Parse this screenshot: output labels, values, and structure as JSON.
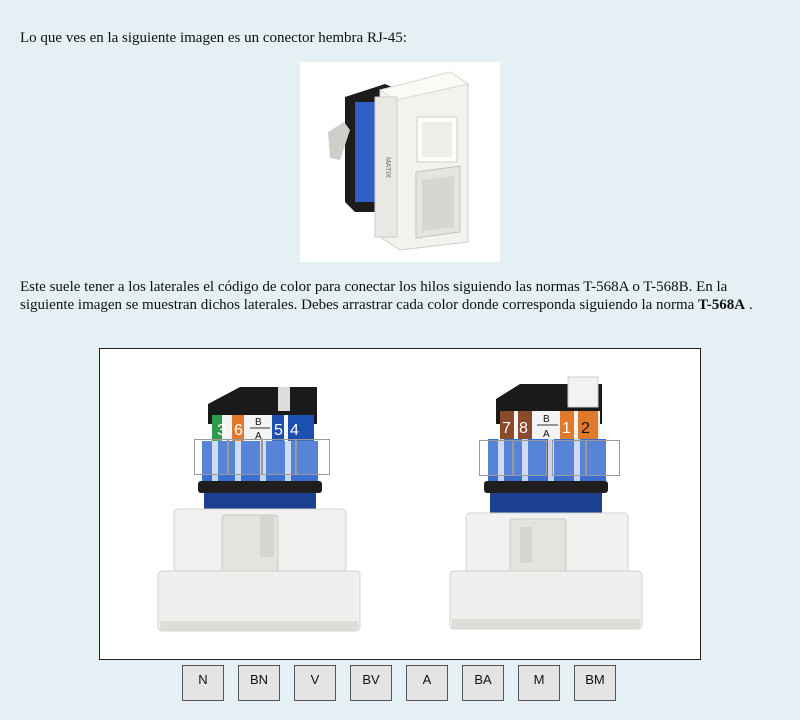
{
  "intro_text": "Lo que ves en la siguiente imagen es un conector hembra RJ-45:",
  "instructions": {
    "text": "Este suele tener a los laterales el código de color para conectar los hilos siguiendo las normas T-568A o T-568B. En la siguiente imagen se muestran dichos laterales. Debes arrastrar cada color donde corresponda siguiendo la norma ",
    "standard": "T-568A",
    "suffix": " ."
  },
  "jack_photo": {
    "brand_label": "MATIX"
  },
  "left_connector": {
    "labels": [
      "3",
      "6",
      "B",
      "A",
      "5",
      "4"
    ]
  },
  "right_connector": {
    "labels": [
      "7",
      "8",
      "B",
      "A",
      "1",
      "2"
    ]
  },
  "colors": {
    "green": "#2e9a4e",
    "orange": "#e07a2a",
    "blue": "#1d4fb0",
    "brown": "#8b4a2b",
    "module_blue": "#3a6fd0",
    "background": "#e4f0f3"
  },
  "tokens": [
    "N",
    "BN",
    "V",
    "BV",
    "A",
    "BA",
    "M",
    "BM"
  ]
}
